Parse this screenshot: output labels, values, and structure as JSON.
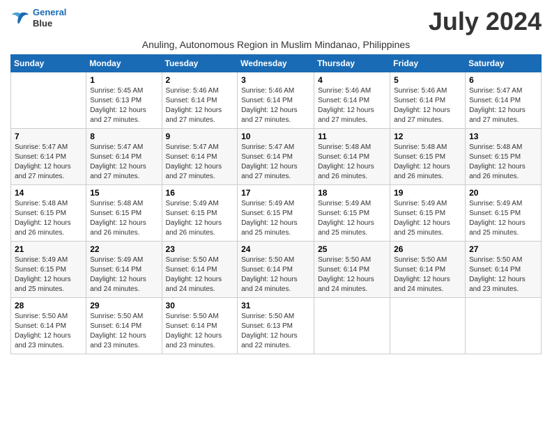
{
  "logo": {
    "line1": "General",
    "line2": "Blue"
  },
  "title": "July 2024",
  "location": "Anuling, Autonomous Region in Muslim Mindanao, Philippines",
  "days_of_week": [
    "Sunday",
    "Monday",
    "Tuesday",
    "Wednesday",
    "Thursday",
    "Friday",
    "Saturday"
  ],
  "weeks": [
    [
      {
        "num": "",
        "info": ""
      },
      {
        "num": "1",
        "info": "Sunrise: 5:45 AM\nSunset: 6:13 PM\nDaylight: 12 hours\nand 27 minutes."
      },
      {
        "num": "2",
        "info": "Sunrise: 5:46 AM\nSunset: 6:14 PM\nDaylight: 12 hours\nand 27 minutes."
      },
      {
        "num": "3",
        "info": "Sunrise: 5:46 AM\nSunset: 6:14 PM\nDaylight: 12 hours\nand 27 minutes."
      },
      {
        "num": "4",
        "info": "Sunrise: 5:46 AM\nSunset: 6:14 PM\nDaylight: 12 hours\nand 27 minutes."
      },
      {
        "num": "5",
        "info": "Sunrise: 5:46 AM\nSunset: 6:14 PM\nDaylight: 12 hours\nand 27 minutes."
      },
      {
        "num": "6",
        "info": "Sunrise: 5:47 AM\nSunset: 6:14 PM\nDaylight: 12 hours\nand 27 minutes."
      }
    ],
    [
      {
        "num": "7",
        "info": "Sunrise: 5:47 AM\nSunset: 6:14 PM\nDaylight: 12 hours\nand 27 minutes."
      },
      {
        "num": "8",
        "info": "Sunrise: 5:47 AM\nSunset: 6:14 PM\nDaylight: 12 hours\nand 27 minutes."
      },
      {
        "num": "9",
        "info": "Sunrise: 5:47 AM\nSunset: 6:14 PM\nDaylight: 12 hours\nand 27 minutes."
      },
      {
        "num": "10",
        "info": "Sunrise: 5:47 AM\nSunset: 6:14 PM\nDaylight: 12 hours\nand 27 minutes."
      },
      {
        "num": "11",
        "info": "Sunrise: 5:48 AM\nSunset: 6:14 PM\nDaylight: 12 hours\nand 26 minutes."
      },
      {
        "num": "12",
        "info": "Sunrise: 5:48 AM\nSunset: 6:15 PM\nDaylight: 12 hours\nand 26 minutes."
      },
      {
        "num": "13",
        "info": "Sunrise: 5:48 AM\nSunset: 6:15 PM\nDaylight: 12 hours\nand 26 minutes."
      }
    ],
    [
      {
        "num": "14",
        "info": "Sunrise: 5:48 AM\nSunset: 6:15 PM\nDaylight: 12 hours\nand 26 minutes."
      },
      {
        "num": "15",
        "info": "Sunrise: 5:48 AM\nSunset: 6:15 PM\nDaylight: 12 hours\nand 26 minutes."
      },
      {
        "num": "16",
        "info": "Sunrise: 5:49 AM\nSunset: 6:15 PM\nDaylight: 12 hours\nand 26 minutes."
      },
      {
        "num": "17",
        "info": "Sunrise: 5:49 AM\nSunset: 6:15 PM\nDaylight: 12 hours\nand 25 minutes."
      },
      {
        "num": "18",
        "info": "Sunrise: 5:49 AM\nSunset: 6:15 PM\nDaylight: 12 hours\nand 25 minutes."
      },
      {
        "num": "19",
        "info": "Sunrise: 5:49 AM\nSunset: 6:15 PM\nDaylight: 12 hours\nand 25 minutes."
      },
      {
        "num": "20",
        "info": "Sunrise: 5:49 AM\nSunset: 6:15 PM\nDaylight: 12 hours\nand 25 minutes."
      }
    ],
    [
      {
        "num": "21",
        "info": "Sunrise: 5:49 AM\nSunset: 6:15 PM\nDaylight: 12 hours\nand 25 minutes."
      },
      {
        "num": "22",
        "info": "Sunrise: 5:49 AM\nSunset: 6:14 PM\nDaylight: 12 hours\nand 24 minutes."
      },
      {
        "num": "23",
        "info": "Sunrise: 5:50 AM\nSunset: 6:14 PM\nDaylight: 12 hours\nand 24 minutes."
      },
      {
        "num": "24",
        "info": "Sunrise: 5:50 AM\nSunset: 6:14 PM\nDaylight: 12 hours\nand 24 minutes."
      },
      {
        "num": "25",
        "info": "Sunrise: 5:50 AM\nSunset: 6:14 PM\nDaylight: 12 hours\nand 24 minutes."
      },
      {
        "num": "26",
        "info": "Sunrise: 5:50 AM\nSunset: 6:14 PM\nDaylight: 12 hours\nand 24 minutes."
      },
      {
        "num": "27",
        "info": "Sunrise: 5:50 AM\nSunset: 6:14 PM\nDaylight: 12 hours\nand 23 minutes."
      }
    ],
    [
      {
        "num": "28",
        "info": "Sunrise: 5:50 AM\nSunset: 6:14 PM\nDaylight: 12 hours\nand 23 minutes."
      },
      {
        "num": "29",
        "info": "Sunrise: 5:50 AM\nSunset: 6:14 PM\nDaylight: 12 hours\nand 23 minutes."
      },
      {
        "num": "30",
        "info": "Sunrise: 5:50 AM\nSunset: 6:14 PM\nDaylight: 12 hours\nand 23 minutes."
      },
      {
        "num": "31",
        "info": "Sunrise: 5:50 AM\nSunset: 6:13 PM\nDaylight: 12 hours\nand 22 minutes."
      },
      {
        "num": "",
        "info": ""
      },
      {
        "num": "",
        "info": ""
      },
      {
        "num": "",
        "info": ""
      }
    ]
  ]
}
